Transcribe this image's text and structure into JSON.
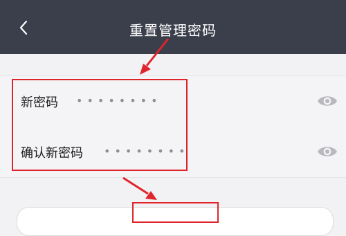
{
  "header": {
    "title": "重置管理密码"
  },
  "form": {
    "new_password_label": "新密码",
    "new_password_value": "••••••••",
    "confirm_password_label": "确认新密码",
    "confirm_password_value": "••••••••"
  },
  "icons": {
    "back": "chevron-left-icon",
    "eye": "eye-icon"
  },
  "colors": {
    "header_bg": "#3b3f4b",
    "annotation": "#e0242b"
  }
}
